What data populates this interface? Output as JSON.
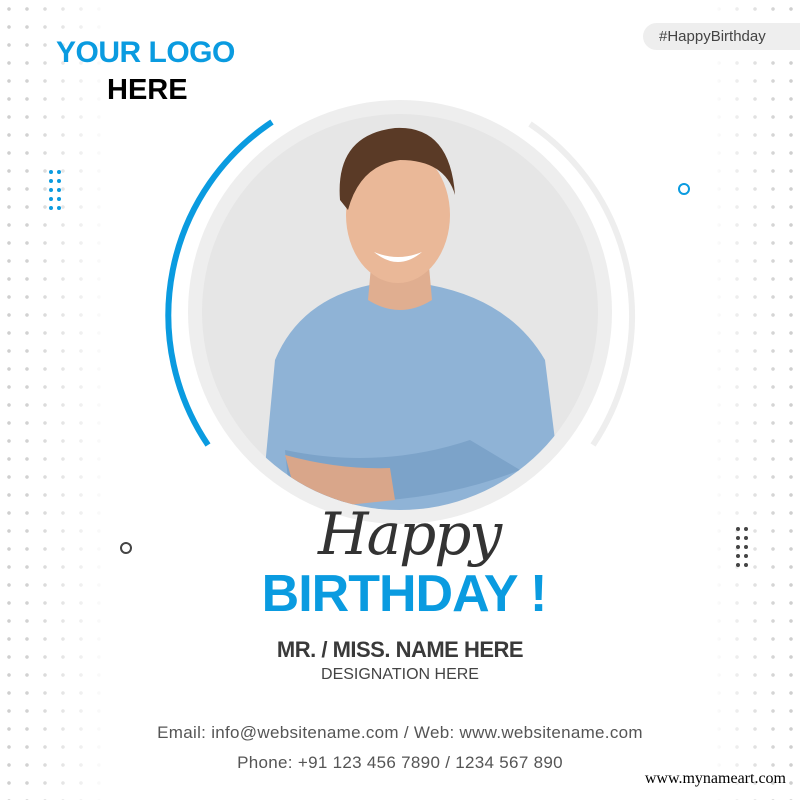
{
  "logo": {
    "line1": "YOUR LOGO",
    "line2": "HERE"
  },
  "hashtag": "#HappyBirthday",
  "greeting": {
    "script": "Happy",
    "main": "BIRTHDAY !"
  },
  "person": {
    "name": "MR. / MISS. NAME HERE",
    "designation": "DESIGNATION HERE"
  },
  "contact": {
    "email_line": "Email: info@websitename.com / Web: www.websitename.com",
    "phone_line": "Phone: +91 123 456 7890 / 1234 567 890"
  },
  "watermark": "www.mynameart.com",
  "colors": {
    "accent": "#0a9be0",
    "ring": "#eeeeee",
    "text_dark": "#3a3a3a"
  }
}
